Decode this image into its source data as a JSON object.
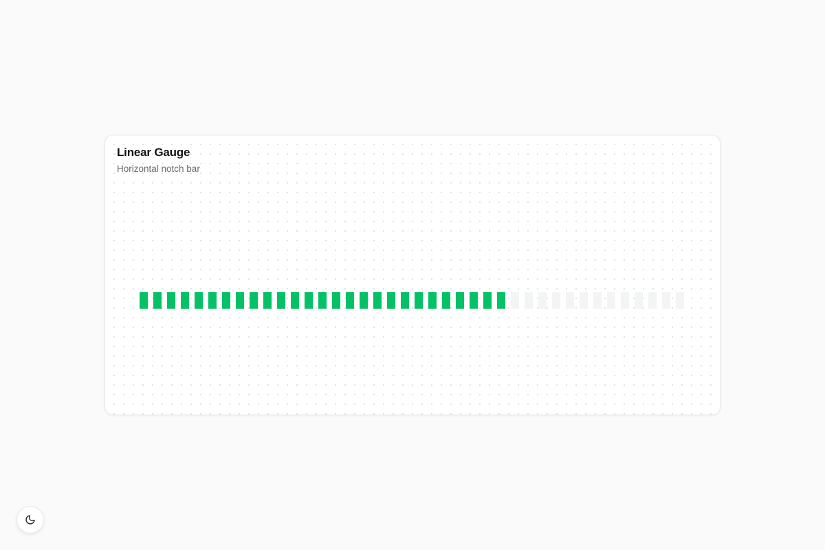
{
  "card": {
    "title": "Linear Gauge",
    "subtitle": "Horizontal notch bar"
  },
  "gauge": {
    "total_notches": 40,
    "filled_notches": 27,
    "value_fraction": 0.675,
    "fill_color": "#05c165",
    "empty_color": "#f3f4f4"
  },
  "theme_toggle": {
    "icon": "moon-icon"
  }
}
